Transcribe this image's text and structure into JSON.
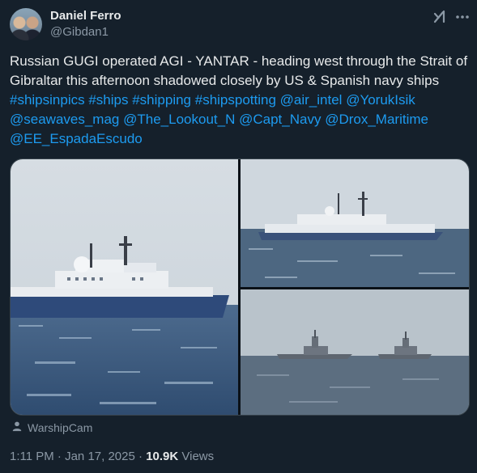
{
  "user": {
    "display_name": "Daniel Ferro",
    "handle": "@Gibdan1"
  },
  "tweet": {
    "text_line1": "Russian GUGI operated AGI - YANTAR - heading west through the Strait of Gibraltar this afternoon shadowed closely by US & Spanish navy ships",
    "hashtags": [
      "#shipsinpics",
      "#ships",
      "#shipping",
      "#shipspotting"
    ],
    "mentions": [
      "@air_intel",
      "@YorukIsik",
      "@seawaves_mag",
      "@The_Lookout_N",
      "@Capt_Navy",
      "@Drox_Maritime",
      "@EE_EspadaEscudo"
    ]
  },
  "media": {
    "source": "WarshipCam"
  },
  "meta": {
    "time": "1:11 PM",
    "date": "Jan 17, 2025",
    "separator": "·",
    "views_count": "10.9K",
    "views_label": "Views"
  },
  "icons": {
    "grok": "grok-icon",
    "more": "more-icon",
    "person": "person-icon"
  },
  "colors": {
    "background": "#15202b",
    "link": "#1d9bf0",
    "text": "#e7e9ea",
    "muted": "#8b98a5"
  }
}
